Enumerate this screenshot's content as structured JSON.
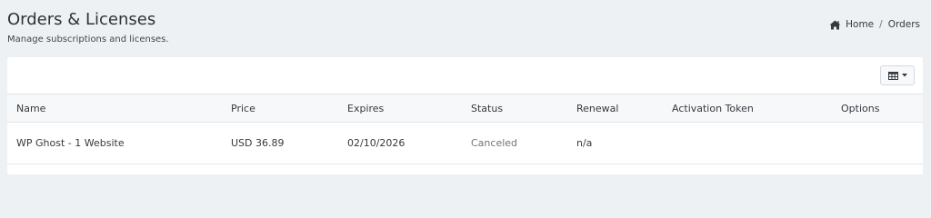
{
  "header": {
    "title": "Orders & Licenses",
    "subtitle": "Manage subscriptions and licenses."
  },
  "breadcrumb": {
    "home_icon": "home-icon",
    "home_label": "Home",
    "separator": "/",
    "current_label": "Orders"
  },
  "toolbar": {
    "columns_icon": "table-columns-icon",
    "dropdown_icon": "caret-down-icon"
  },
  "table": {
    "columns": [
      "Name",
      "Price",
      "Expires",
      "Status",
      "Renewal",
      "Activation Token",
      "Options"
    ],
    "rows": [
      {
        "name": "WP Ghost - 1 Website",
        "price": "USD 36.89",
        "expires": "02/10/2026",
        "status": "Canceled",
        "renewal": "n/a",
        "activation_token": "",
        "options": ""
      }
    ]
  },
  "colors": {
    "page_background": "#eef1f3",
    "card_background": "#ffffff",
    "status_canceled": "#6c757d"
  }
}
